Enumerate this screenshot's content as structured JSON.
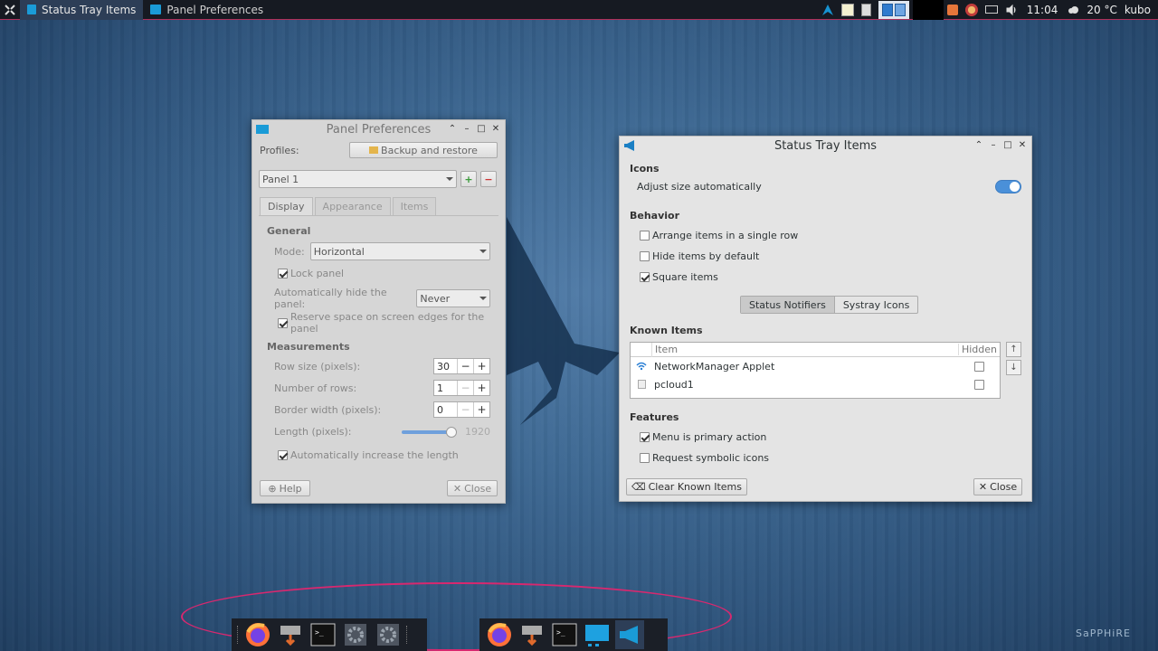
{
  "taskbar": {
    "tasks": [
      {
        "label": "Status Tray Items"
      },
      {
        "label": "Panel Preferences"
      }
    ],
    "clock": "11:04",
    "weather": "20 °C",
    "user": "kubo"
  },
  "panel_prefs": {
    "title": "Panel Preferences",
    "profiles_label": "Profiles:",
    "backup_button": "Backup and restore",
    "panel_select": "Panel 1",
    "tabs": [
      "Display",
      "Appearance",
      "Items"
    ],
    "general_heading": "General",
    "mode_label": "Mode:",
    "mode_value": "Horizontal",
    "lock_panel": "Lock panel",
    "autohide_label": "Automatically hide the panel:",
    "autohide_value": "Never",
    "reserve_space": "Reserve space on screen edges for the panel",
    "measurements_heading": "Measurements",
    "row_size_label": "Row size (pixels):",
    "row_size_value": "30",
    "rows_label": "Number of rows:",
    "rows_value": "1",
    "border_label": "Border width (pixels):",
    "border_value": "0",
    "length_label": "Length (pixels):",
    "length_value": "1920",
    "auto_length": "Automatically increase the length",
    "help_button": "Help",
    "close_button": "Close"
  },
  "status_tray": {
    "title": "Status Tray Items",
    "icons_heading": "Icons",
    "adjust_size": "Adjust size automatically",
    "behavior_heading": "Behavior",
    "single_row": "Arrange items in a single row",
    "hide_default": "Hide items by default",
    "square_items": "Square items",
    "seg_notifiers": "Status Notifiers",
    "seg_systray": "Systray Icons",
    "known_heading": "Known Items",
    "col_item": "Item",
    "col_hidden": "Hidden",
    "items": [
      {
        "name": "NetworkManager Applet"
      },
      {
        "name": "pcloud1"
      }
    ],
    "features_heading": "Features",
    "menu_primary": "Menu is primary action",
    "symbolic_icons": "Request symbolic icons",
    "clear_button": "Clear Known Items",
    "close_button": "Close"
  },
  "watermark": "SaPPHiRE",
  "colors": {
    "accent": "#4a90d9",
    "panel": "#161a22",
    "ring": "#d8286f"
  }
}
